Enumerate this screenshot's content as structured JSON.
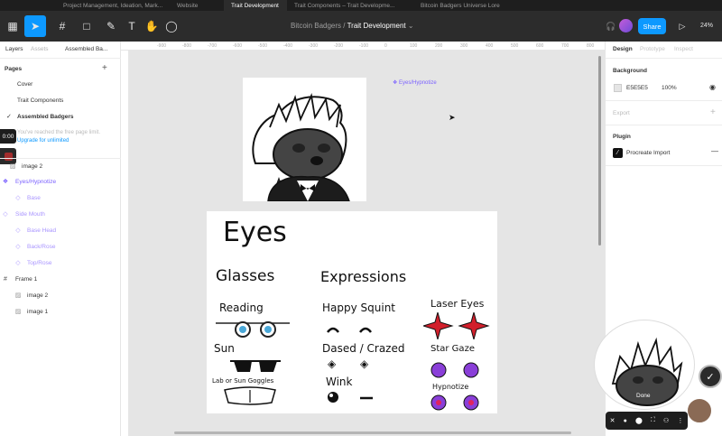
{
  "browser_tabs": [
    {
      "label": "Project Management, Ideation, Mark...",
      "active": false
    },
    {
      "label": "Website",
      "active": false
    },
    {
      "label": "Trait Development",
      "active": true
    },
    {
      "label": "Trait Components – Trait Developme...",
      "active": false
    },
    {
      "label": "Bitcoin Badgers Universe Lore",
      "active": false
    }
  ],
  "breadcrumb": {
    "project": "Bitcoin Badgers",
    "separator": "/",
    "file": "Trait Development"
  },
  "toolbar": {
    "share_label": "Share",
    "zoom": "24%"
  },
  "left_panel": {
    "tabs": {
      "layers": "Layers",
      "assets": "Assets",
      "page": "Assembled Ba..."
    },
    "pages_title": "Pages",
    "pages": [
      "Cover",
      "Trait Components",
      "Assembled Badgers"
    ],
    "limit_msg": "You've reached the free page limit.",
    "upgrade_link": "Upgrade for unlimited",
    "timer": "0:00",
    "layers": [
      {
        "label": "image 2",
        "indent": 1,
        "icon": "image-icon"
      },
      {
        "label": "Eyes/Hypnotize",
        "indent": 0,
        "icon": "component-icon",
        "style": "purple"
      },
      {
        "label": "Base",
        "indent": 1,
        "icon": "instance-icon",
        "style": "lightp"
      },
      {
        "label": "Side Mouth",
        "indent": 0,
        "icon": "instance-icon",
        "style": "lightp"
      },
      {
        "label": "Base Head",
        "indent": 1,
        "icon": "instance-icon",
        "style": "lightp"
      },
      {
        "label": "Back/Rose",
        "indent": 1,
        "icon": "instance-icon",
        "style": "lightp"
      },
      {
        "label": "Top/Rose",
        "indent": 1,
        "icon": "instance-icon",
        "style": "lightp"
      },
      {
        "label": "Frame 1",
        "indent": 0,
        "icon": "frame-icon"
      },
      {
        "label": "image 2",
        "indent": 1,
        "icon": "image-icon"
      },
      {
        "label": "image 1",
        "indent": 1,
        "icon": "image-icon"
      }
    ]
  },
  "ruler_ticks": [
    "-900",
    "-800",
    "-700",
    "-600",
    "-500",
    "-400",
    "-300",
    "-200",
    "-100",
    "0",
    "100",
    "200",
    "300",
    "400",
    "500",
    "600",
    "700",
    "800"
  ],
  "canvas": {
    "component_label": "Eyes/Hypnotize",
    "sheet_title": "Eyes",
    "glasses_heading": "Glasses",
    "expressions_heading": "Expressions",
    "reading": "Reading",
    "sun": "Sun",
    "lab": "Lab or Sun Goggles",
    "happy_squint": "Happy Squint",
    "dazed": "Dased / Crazed",
    "wink": "Wink",
    "laser_eyes": "Laser Eyes",
    "star_gaze": "Star Gaze",
    "hypnotize": "Hypnotize"
  },
  "right_panel": {
    "tabs": {
      "design": "Design",
      "prototype": "Prototype",
      "inspect": "Inspect"
    },
    "background_title": "Background",
    "bg_hex": "E5E5E5",
    "bg_opacity": "100%",
    "export_title": "Export",
    "plugin_title": "Plugin",
    "plugin_name": "Procreate Import"
  },
  "overlay": {
    "done_label": "Done"
  },
  "colors": {
    "accent": "#0d99ff",
    "component": "#7b61ff",
    "canvas_bg": "#e5e5e5",
    "toolbar": "#2c2c2c"
  }
}
